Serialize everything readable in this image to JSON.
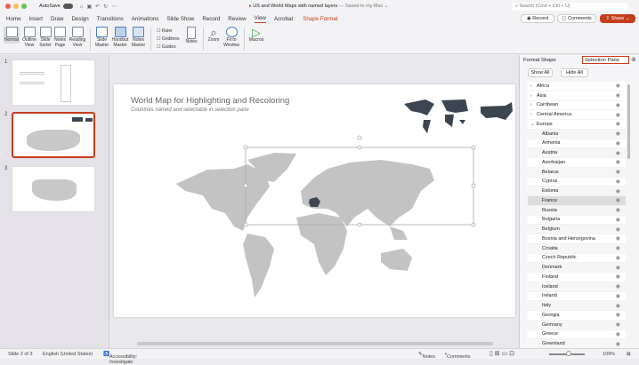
{
  "window": {
    "autosave": "AutoSave",
    "title": "US and World Maps with named layers",
    "saved": "— Saved to my Mac ⌄",
    "search_placeholder": "Search (Cmd + Ctrl + U)"
  },
  "tabs": [
    "Home",
    "Insert",
    "Draw",
    "Design",
    "Transitions",
    "Animations",
    "Slide Show",
    "Record",
    "Review",
    "View",
    "Acrobat",
    "Shape Format"
  ],
  "actions": {
    "record": "Record",
    "comments": "Comments",
    "share": "Share"
  },
  "ribbon": {
    "views": [
      "Normal",
      "Outline View",
      "Slide Sorter",
      "Notes Page",
      "Reading View"
    ],
    "masters": [
      "Slide Master",
      "Handout Master",
      "Notes Master"
    ],
    "show": [
      "Ruler",
      "Gridlines",
      "Guides"
    ],
    "notes": "Notes",
    "zoom": "Zoom",
    "fit": "Fit to Window",
    "macros": "Macros"
  },
  "slides": {
    "numbers": [
      "1",
      "2",
      "3"
    ],
    "selected": 2
  },
  "slide": {
    "title": "World Map for Highlighting and Recoloring",
    "subtitle": "Countries named and selectable in selection pane"
  },
  "pane": {
    "tab1": "Format Shape",
    "tab2": "Selection Pane",
    "show_all": "Show All",
    "hide_all": "Hide All",
    "groups": [
      "Africa",
      "Asia",
      "Carribean",
      "Central America",
      "Europe"
    ],
    "europe": [
      "Albania",
      "Armenia",
      "Austria",
      "Azerbaijan",
      "Belarus",
      "Cyprus",
      "Estonia",
      "France",
      "Russia",
      "Bulgaria",
      "Belgium",
      "Bosnia and Herzegovina",
      "Croatia",
      "Czech Republic",
      "Denmark",
      "Finland",
      "Iceland",
      "Ireland",
      "Italy",
      "Georgia",
      "Germany",
      "Greece",
      "Greenland"
    ],
    "selected": "France"
  },
  "status": {
    "slide": "Slide 2 of 3",
    "language": "English (United States)",
    "accessibility": "Accessibility: Investigate",
    "notes": "Notes",
    "comments": "Comments",
    "zoom": "109%",
    "zoom_fraction": 0.55
  },
  "colors": {
    "accent": "#c43e1c",
    "map": "#c3c3c3",
    "highlight": "#3b4650"
  }
}
